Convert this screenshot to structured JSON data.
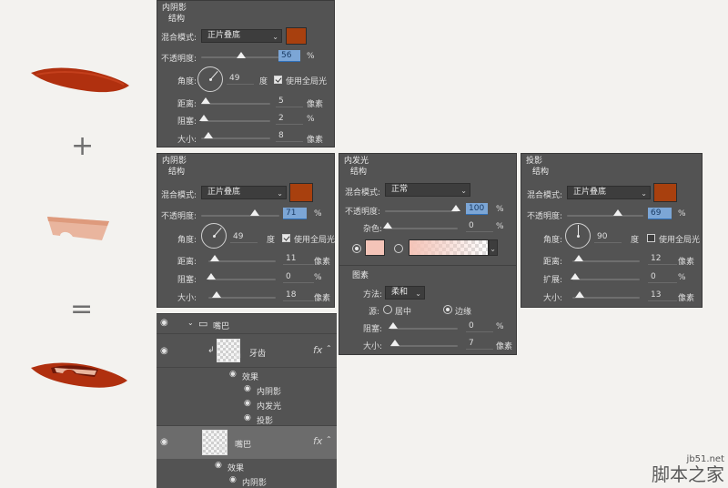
{
  "illustration": {
    "plus": "+",
    "equals": "=",
    "colors": {
      "lip": "#b0300f",
      "tooth": "#e9b59e",
      "inner": "#6e1708"
    }
  },
  "panel_inner_shadow_1": {
    "title": "内阴影",
    "section": "结构",
    "blend_label": "混合模式:",
    "blend_value": "正片叠底",
    "swatch": "#a8400e",
    "opacity_label": "不透明度:",
    "opacity_value": "56",
    "opacity_unit": "%",
    "opacity_pct": 56,
    "angle_label": "角度:",
    "angle_value": "49",
    "angle_unit": "度",
    "global_light": "使用全局光",
    "distance_label": "距离:",
    "distance_value": "5",
    "distance_unit": "像素",
    "choke_label": "阻塞:",
    "choke_value": "2",
    "choke_unit": "%",
    "size_label": "大小:",
    "size_value": "8",
    "size_unit": "像素"
  },
  "panel_inner_shadow_2": {
    "title": "内阴影",
    "section": "结构",
    "blend_label": "混合模式:",
    "blend_value": "正片叠底",
    "swatch": "#a8400e",
    "opacity_label": "不透明度:",
    "opacity_value": "71",
    "opacity_unit": "%",
    "angle_label": "角度:",
    "angle_value": "49",
    "angle_unit": "度",
    "global_light": "使用全局光",
    "distance_label": "距离:",
    "distance_value": "11",
    "distance_unit": "像素",
    "choke_label": "阻塞:",
    "choke_value": "0",
    "choke_unit": "%",
    "size_label": "大小:",
    "size_value": "18",
    "size_unit": "像素"
  },
  "panel_inner_glow": {
    "title": "内发光",
    "section": "结构",
    "blend_label": "混合模式:",
    "blend_value": "正常",
    "opacity_label": "不透明度:",
    "opacity_value": "100",
    "opacity_unit": "%",
    "noise_label": "杂色:",
    "noise_value": "0",
    "noise_unit": "%",
    "glow_color": "#f4c4b8",
    "elements_section": "图素",
    "method_label": "方法:",
    "method_value": "柔和",
    "source_label": "源:",
    "source_center": "居中",
    "source_edge": "边缘",
    "choke_label": "阻塞:",
    "choke_value": "0",
    "choke_unit": "%",
    "size_label": "大小:",
    "size_value": "7",
    "size_unit": "像素"
  },
  "panel_drop_shadow": {
    "title": "投影",
    "section": "结构",
    "blend_label": "混合模式:",
    "blend_value": "正片叠底",
    "swatch": "#a8400e",
    "opacity_label": "不透明度:",
    "opacity_value": "69",
    "opacity_unit": "%",
    "angle_label": "角度:",
    "angle_value": "90",
    "angle_unit": "度",
    "global_light": "使用全局光",
    "distance_label": "距离:",
    "distance_value": "12",
    "distance_unit": "像素",
    "spread_label": "扩展:",
    "spread_value": "0",
    "spread_unit": "%",
    "size_label": "大小:",
    "size_value": "13",
    "size_unit": "像素"
  },
  "layers": {
    "group_name": "嘴巴",
    "teeth_layer": "牙齿",
    "effects": "效果",
    "inner_shadow": "内阴影",
    "inner_glow": "内发光",
    "drop_shadow": "投影",
    "mouth_layer": "嘴巴",
    "effects2": "效果",
    "inner_shadow2": "内阴影",
    "fx": "fx"
  },
  "watermark": {
    "url": "jb51.net",
    "cn": "脚本之家"
  }
}
